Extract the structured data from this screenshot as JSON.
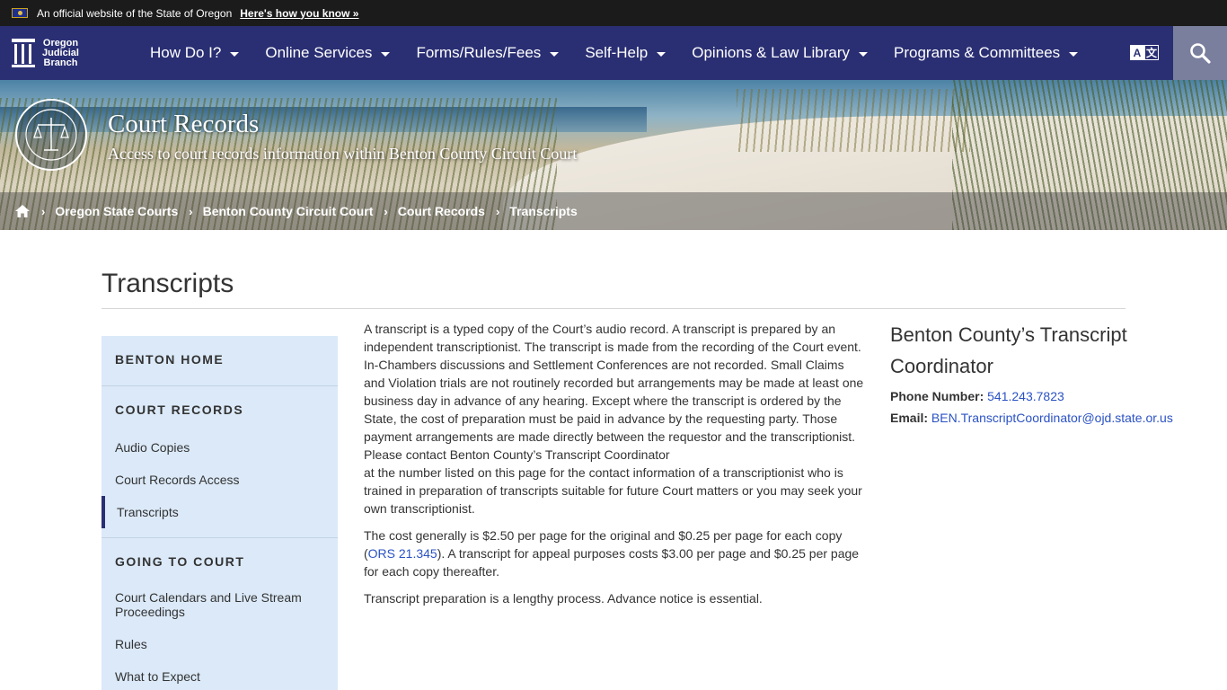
{
  "topbar": {
    "official_text": "An official website of the State of Oregon",
    "how_link": "Here's how you know »"
  },
  "logo": {
    "line1": "Oregon",
    "line2": "Judicial",
    "line3": "Branch"
  },
  "nav": {
    "items": [
      {
        "label": "How Do I?"
      },
      {
        "label": "Online Services"
      },
      {
        "label": "Forms/Rules/Fees"
      },
      {
        "label": "Self-Help"
      },
      {
        "label": "Opinions & Law Library"
      },
      {
        "label": "Programs & Committees"
      }
    ],
    "translate_a": "A",
    "translate_b": "文",
    "icons": [
      "translate-icon",
      "search-icon"
    ]
  },
  "hero": {
    "title": "Court Records",
    "subtitle": "Access to court records information within Benton County Circuit Court"
  },
  "breadcrumb": [
    {
      "label": "Oregon State Courts"
    },
    {
      "label": "Benton County Circuit Court"
    },
    {
      "label": "Court Records"
    },
    {
      "label": "Transcripts"
    }
  ],
  "page": {
    "title": "Transcripts"
  },
  "sidebar": {
    "benton_home": "BENTON HOME",
    "court_records": "COURT RECORDS",
    "court_records_links": [
      "Audio Copies",
      "Court Records Access",
      "Transcripts"
    ],
    "going_to_court": "GOING TO COURT",
    "going_links": [
      "Court Calendars and Live Stream Proceedings",
      "Rules",
      "What to Expect"
    ]
  },
  "content": {
    "p1a": "A transcript is a typed copy of the Court’s audio record.  A transcript is prepared by an independent transcriptionist.  The transcript is made from the recording of the Court event.  In-Chambers discussions and Settlement Conferences are not recorded.  Small Claims and Violation trials are not routinely recorded but arrangements may be made at least one business day in advance of any hearing.  Except where the transcript is ordered by the State, the cost of preparation must be paid in advance by the requesting party.  Those payment arrangements are made directly between the requestor and the transcriptionist.  Please contact Benton County’s Transcript Coordinator",
    "p1b": "at the number listed on this page for the contact information of a transcriptionist who is trained in preparation of transcripts suitable for future Court matters or you may seek your own transcriptionist.",
    "p2a": "The cost generally is $2.50 per page for the original and $0.25 per page for each copy (",
    "p2_link": "ORS 21.345",
    "p2b": ").  A transcript for appeal purposes costs $3.00 per page and $0.25 per page for each copy thereafter.",
    "p3": "Transcript preparation is a lengthy process.  Advance notice is essential."
  },
  "aside": {
    "heading": "Benton County’s Transcript Coordinator",
    "phone_label": "Phone Number:",
    "phone": "541.243.7823",
    "email_label": "Email:",
    "email": "BEN.TranscriptCoordinator@ojd.state.or.us"
  }
}
